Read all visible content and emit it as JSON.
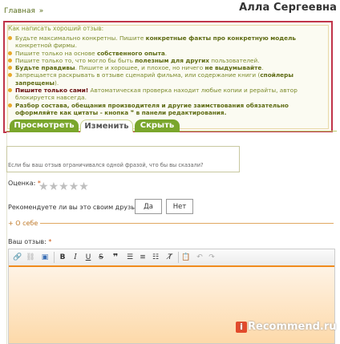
{
  "breadcrumb": {
    "home": "Главная",
    "sep": "»"
  },
  "header": {
    "username": "Алла Сергеевна"
  },
  "tips": {
    "title": "Как написать хороший отзыв:",
    "items": [
      {
        "pre": "Будьте максимально конкретны. Пишите ",
        "bold": "конкретные факты про конкретную модель",
        "post": " конкретной фирмы."
      },
      {
        "pre": "Пишите только на основе ",
        "bold": "собственного опыта",
        "post": "."
      },
      {
        "pre": "Пишите только то, что могло бы быть ",
        "bold": "полезным для других",
        "post": " пользователей."
      },
      {
        "pre": "",
        "bold": "Будьте правдивы",
        "post": ". Пишите и хорошее, и плохое, но ничего ",
        "bold2": "не выдумывайте",
        "post2": "."
      },
      {
        "pre": "Запрещается раскрывать в отзыве сценарий фильма, или содержание книги (",
        "bold": "спойлеры запрещены",
        "post": ")."
      },
      {
        "pre": "",
        "bold": "Пишите только сами!",
        "post": " Автоматическая проверка находит любые копии и рерайты, автор блокируется навсегда."
      },
      {
        "pre": "",
        "bold": "Разбор состава, обещания производителя и другие заимствования обязательно оформляйте как цитаты - кнопка ❞ в панели редактирования.",
        "post": ""
      }
    ]
  },
  "tabs": [
    "Просмотреть",
    "Изменить",
    "Скрыть"
  ],
  "form": {
    "summary_hint": "Если бы ваш отзыв ограничивался одной фразой, что бы вы сказали?",
    "rating_label": "Оценка:",
    "req": "*",
    "recommend_label": "Рекомендуете ли вы это своим друзьям?:",
    "yes": "Да",
    "no": "Нет",
    "about": "+ О себе",
    "review_label": "Ваш отзыв:"
  },
  "toolbar_icons": [
    "link-icon",
    "unlink-icon",
    "image-icon",
    "bold-icon",
    "italic-icon",
    "underline-icon",
    "strike-icon",
    "quote-icon",
    "numbered-list-icon",
    "bullet-list-icon",
    "align-icon",
    "clear-format-icon",
    "paste-icon",
    "undo-icon",
    "redo-icon"
  ],
  "watermark": {
    "brand": "Recommend.ru",
    "letter": "i"
  }
}
